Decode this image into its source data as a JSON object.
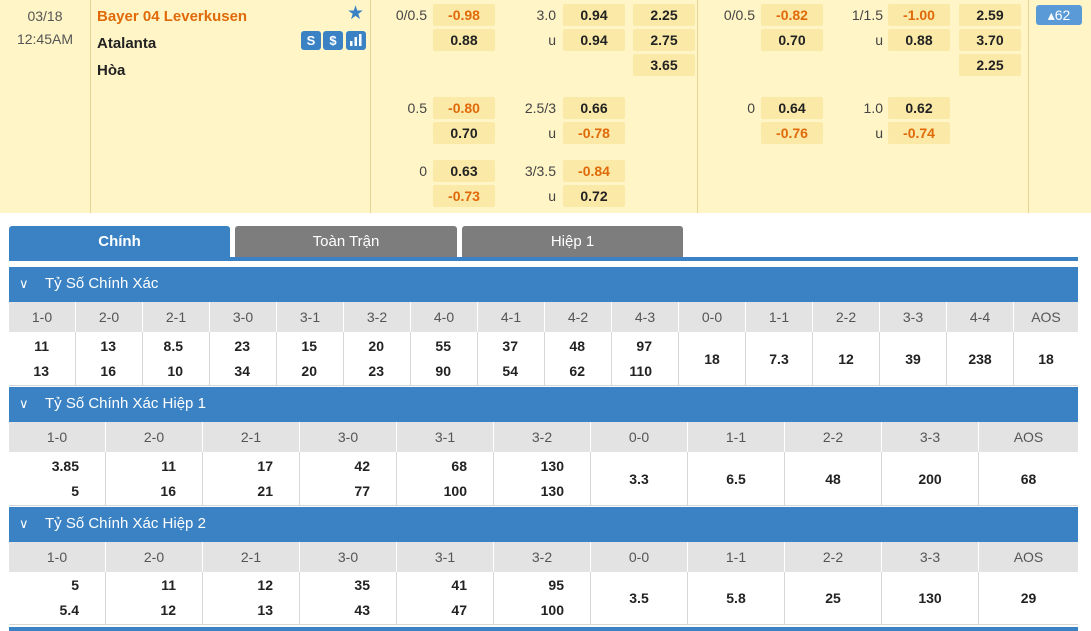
{
  "match": {
    "date": "03/18",
    "time": "12:45AM",
    "home": "Bayer 04 Leverkusen",
    "away": "Atalanta",
    "draw": "Hòa",
    "icons": [
      "favorite-star-icon",
      "stats-s-icon",
      "dollar-icon",
      "bar-chart-icon"
    ],
    "icon_glyphs": {
      "s": "S",
      "dollar": "$"
    },
    "more": "▴62",
    "lines": [
      {
        "id": "ft_hdp_1",
        "label": "0/0.5",
        "a": "-0.98",
        "b": "0.88"
      },
      {
        "id": "ft_ou_1",
        "label": "3.0",
        "label2": "u",
        "a": "0.94",
        "b": "0.94"
      },
      {
        "id": "ft_1x2",
        "a": "2.25",
        "b": "2.75",
        "c": "3.65"
      },
      {
        "id": "h1_hdp_1",
        "label": "0/0.5",
        "a": "-0.82",
        "b": "0.70"
      },
      {
        "id": "h1_ou_1",
        "label": "1/1.5",
        "label2": "u",
        "a": "-1.00",
        "b": "0.88"
      },
      {
        "id": "h1_1x2",
        "a": "2.59",
        "b": "3.70",
        "c": "2.25"
      },
      {
        "id": "ft_hdp_2",
        "label": "0.5",
        "a": "-0.80",
        "b": "0.70"
      },
      {
        "id": "ft_ou_2",
        "label": "2.5/3",
        "label2": "u",
        "a": "0.66",
        "b": "-0.78"
      },
      {
        "id": "h1_hdp_2",
        "label": "0",
        "a": "0.64",
        "b": "-0.76"
      },
      {
        "id": "h1_ou_2",
        "label": "1.0",
        "label2": "u",
        "a": "0.62",
        "b": "-0.74"
      },
      {
        "id": "ft_hdp_3",
        "label": "0",
        "a": "0.63",
        "b": "-0.73"
      },
      {
        "id": "ft_ou_3",
        "label": "3/3.5",
        "label2": "u",
        "a": "-0.84",
        "b": "0.72"
      }
    ]
  },
  "tabs": [
    {
      "label": "Chính",
      "active": true
    },
    {
      "label": "Toàn Trận",
      "active": false
    },
    {
      "label": "Hiệp 1",
      "active": false
    }
  ],
  "sections": [
    {
      "title": "Tỷ Số Chính Xác",
      "chevron": "∨",
      "columns": [
        "1-0",
        "2-0",
        "2-1",
        "3-0",
        "3-1",
        "3-2",
        "4-0",
        "4-1",
        "4-2",
        "4-3",
        "0-0",
        "1-1",
        "2-2",
        "3-3",
        "4-4",
        "AOS"
      ],
      "home": [
        "11",
        "13",
        "8.5",
        "23",
        "15",
        "20",
        "55",
        "37",
        "48",
        "97"
      ],
      "away": [
        "13",
        "16",
        "10",
        "34",
        "20",
        "23",
        "90",
        "54",
        "62",
        "110"
      ],
      "single": [
        "18",
        "7.3",
        "12",
        "39",
        "238",
        "18"
      ]
    },
    {
      "title": "Tỷ Số Chính Xác Hiệp 1",
      "chevron": "∨",
      "columns": [
        "1-0",
        "2-0",
        "2-1",
        "3-0",
        "3-1",
        "3-2",
        "0-0",
        "1-1",
        "2-2",
        "3-3",
        "AOS"
      ],
      "home": [
        "3.85",
        "11",
        "17",
        "42",
        "68",
        "130"
      ],
      "away": [
        "5",
        "16",
        "21",
        "77",
        "100",
        "130"
      ],
      "single": [
        "3.3",
        "6.5",
        "48",
        "200",
        "68"
      ]
    },
    {
      "title": "Tỷ Số Chính Xác Hiệp 2",
      "chevron": "∨",
      "columns": [
        "1-0",
        "2-0",
        "2-1",
        "3-0",
        "3-1",
        "3-2",
        "0-0",
        "1-1",
        "2-2",
        "3-3",
        "AOS"
      ],
      "home": [
        "5",
        "11",
        "12",
        "35",
        "41",
        "95"
      ],
      "away": [
        "5.4",
        "12",
        "13",
        "43",
        "47",
        "100"
      ],
      "single": [
        "3.5",
        "5.8",
        "25",
        "130",
        "29"
      ]
    }
  ],
  "colors": {
    "accent": "#3a82c4",
    "home_team": "#e06a0a",
    "negative": "#e06a0a",
    "header_bg": "#fff5c6",
    "odds_box": "#fbe9a8"
  }
}
